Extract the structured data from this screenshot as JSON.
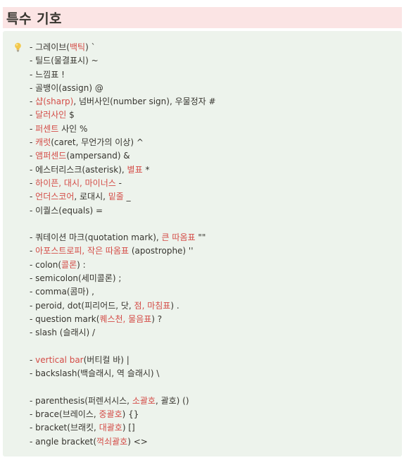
{
  "heading": {
    "title": "특수 기호"
  },
  "callout": {
    "icon": "lightbulb-icon",
    "lines": [
      [
        {
          "t": "- 그레이브("
        },
        {
          "t": "백틱",
          "red": true
        },
        {
          "t": ") `"
        }
      ],
      [
        {
          "t": "- 틸드(물결표시) ~"
        }
      ],
      [
        {
          "t": "- 느낌표 !"
        }
      ],
      [
        {
          "t": "- 골뱅이(assign) @"
        }
      ],
      [
        {
          "t": "- "
        },
        {
          "t": "샵(sharp)",
          "red": true
        },
        {
          "t": ", 넘버사인(number sign), 우물정자 #"
        }
      ],
      [
        {
          "t": "- "
        },
        {
          "t": "달러사인",
          "red": true
        },
        {
          "t": " $"
        }
      ],
      [
        {
          "t": "- "
        },
        {
          "t": "퍼센트",
          "red": true
        },
        {
          "t": " 사인 %"
        }
      ],
      [
        {
          "t": "- "
        },
        {
          "t": "캐럿",
          "red": true
        },
        {
          "t": "(caret, 무언가의 이상) ^"
        }
      ],
      [
        {
          "t": "- "
        },
        {
          "t": "앰퍼센드",
          "red": true
        },
        {
          "t": "(ampersand) &"
        }
      ],
      [
        {
          "t": "- 에스터리스크(asterisk), "
        },
        {
          "t": "별표",
          "red": true
        },
        {
          "t": " *"
        }
      ],
      [
        {
          "t": "- "
        },
        {
          "t": "하이픈, 대시, 마이너스",
          "red": true
        },
        {
          "t": " -"
        }
      ],
      [
        {
          "t": "- "
        },
        {
          "t": "언더스코어",
          "red": true
        },
        {
          "t": ", 로대시, "
        },
        {
          "t": "밑줄",
          "red": true
        },
        {
          "t": " _"
        }
      ],
      [
        {
          "t": "- 이퀄스(equals) ="
        }
      ],
      [],
      [
        {
          "t": "- 쿼테이션 마크(quotation mark), "
        },
        {
          "t": "큰 따옴표",
          "red": true
        },
        {
          "t": " \"\""
        }
      ],
      [
        {
          "t": "- "
        },
        {
          "t": "아포스트로피, 작은 따옴표",
          "red": true
        },
        {
          "t": " (apostrophe) ''"
        }
      ],
      [
        {
          "t": "- colon("
        },
        {
          "t": "콜론",
          "red": true
        },
        {
          "t": ") :"
        }
      ],
      [
        {
          "t": "- semicolon(세미콜론) ;"
        }
      ],
      [
        {
          "t": "- comma(콤마) ,"
        }
      ],
      [
        {
          "t": "- peroid, dot(피리어드, 닷, "
        },
        {
          "t": "점, 마침표",
          "red": true
        },
        {
          "t": ") ."
        }
      ],
      [
        {
          "t": "- question mark("
        },
        {
          "t": "퀘스천, 물음표",
          "red": true
        },
        {
          "t": ") ?"
        }
      ],
      [
        {
          "t": "- slash (슬래시) /"
        }
      ],
      [],
      [
        {
          "t": "- "
        },
        {
          "t": "vertical bar",
          "red": true
        },
        {
          "t": "(버티컬 바) |"
        }
      ],
      [
        {
          "t": "- backslash(백슬래시, 역 슬래시) \\"
        }
      ],
      [],
      [
        {
          "t": "- parenthesis(퍼렌서시스, "
        },
        {
          "t": "소괄호",
          "red": true
        },
        {
          "t": ", 괄호) ()"
        }
      ],
      [
        {
          "t": "- brace(브레이스, "
        },
        {
          "t": "중괄호",
          "red": true
        },
        {
          "t": ") {}"
        }
      ],
      [
        {
          "t": "- bracket(브래킷, "
        },
        {
          "t": "대괄호",
          "red": true
        },
        {
          "t": ") []"
        }
      ],
      [
        {
          "t": "- angle bracket("
        },
        {
          "t": "꺽쇠괄호",
          "red": true
        },
        {
          "t": ") <>"
        }
      ]
    ]
  },
  "colors": {
    "heading_bg": "#fbe4e4",
    "callout_bg": "#edf3ec",
    "text": "#37352f",
    "highlight_red": "#d44c47",
    "bulb": "#f2c94c"
  }
}
